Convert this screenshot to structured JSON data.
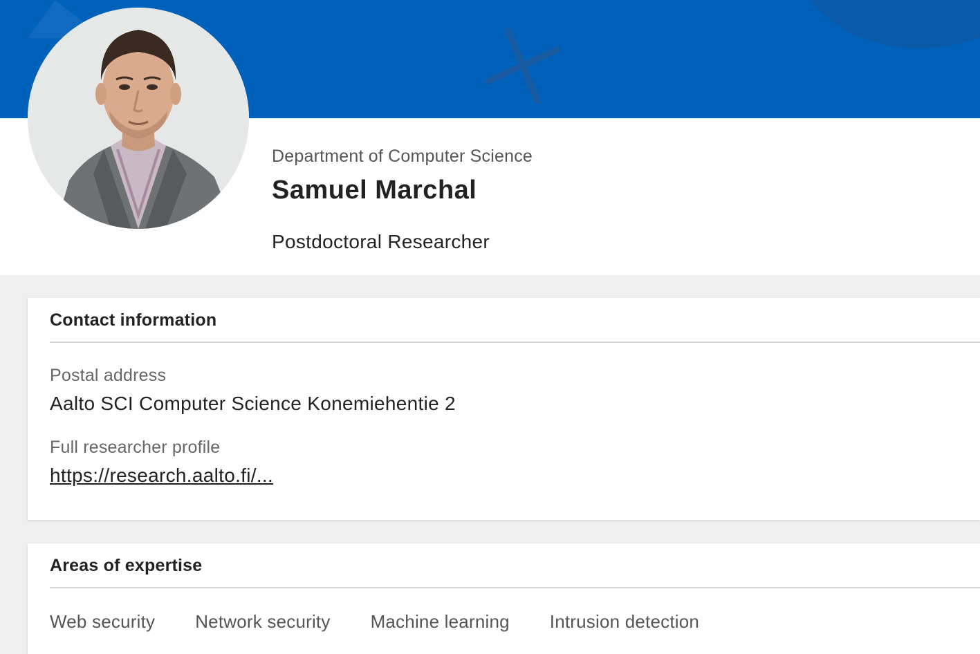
{
  "profile": {
    "department": "Department of Computer Science",
    "name": "Samuel Marchal",
    "title": "Postdoctoral Researcher"
  },
  "colors": {
    "banner": "#0061bb",
    "page_background": "#efefef"
  },
  "contact": {
    "heading": "Contact information",
    "postal_label": "Postal address",
    "postal_value": "Aalto SCI Computer Science Konemiehentie 2",
    "profile_label": "Full researcher profile",
    "profile_link": "https://research.aalto.fi/..."
  },
  "expertise": {
    "heading": "Areas of expertise",
    "areas": [
      "Web security",
      "Network security",
      "Machine learning",
      "Intrusion detection"
    ]
  }
}
